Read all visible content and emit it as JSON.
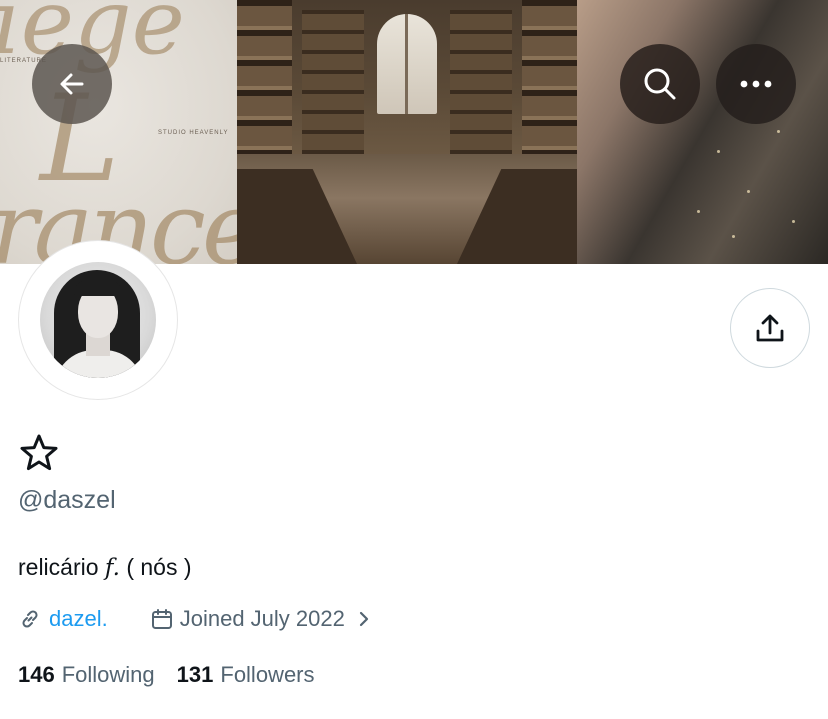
{
  "banner": {
    "left_panel_script_words": [
      "iege",
      "L",
      "rance"
    ],
    "left_panel_small_text_top": "LITERATURE",
    "left_panel_small_text_bottom": "STUDIO HEAVENLY"
  },
  "header_buttons": {
    "back_icon": "arrow-left-icon",
    "search_icon": "search-icon",
    "more_icon": "more-horizontal-icon"
  },
  "profile": {
    "display_name_icon": "star-outline-icon",
    "handle": "@daszel",
    "bio_before": "relicário ",
    "bio_f": "f.",
    "bio_after": " ( nós )",
    "website_label": "dazel.",
    "joined_label": "Joined July 2022",
    "following_count": "146",
    "following_label": "Following",
    "followers_count": "131",
    "followers_label": "Followers"
  },
  "colors": {
    "link": "#1d9bf0",
    "secondary_text": "#536471",
    "primary_text": "#0f1419"
  }
}
